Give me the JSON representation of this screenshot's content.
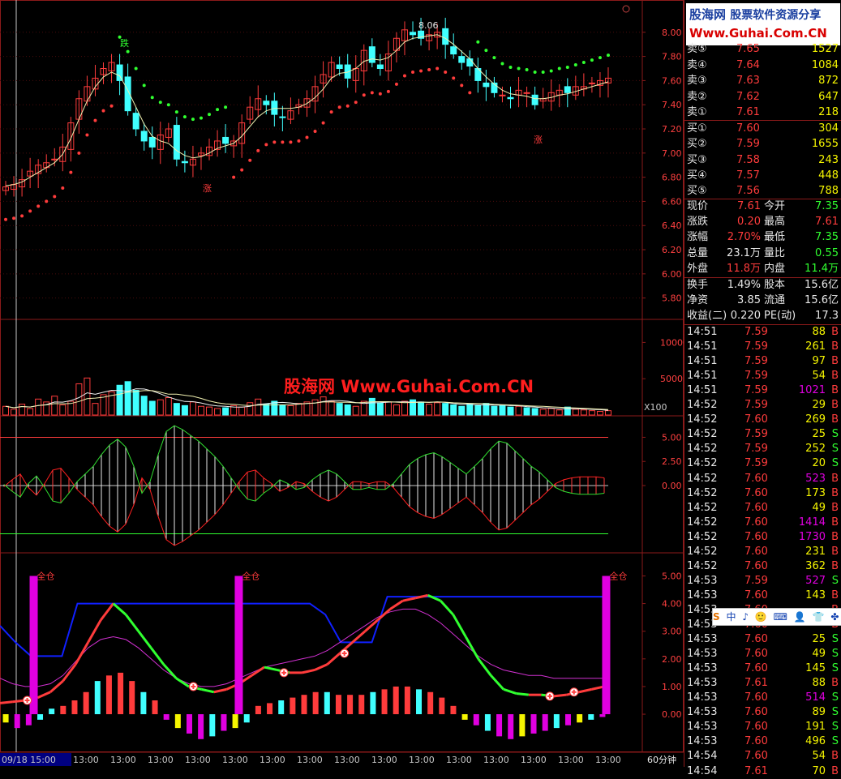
{
  "chart_data": [
    {
      "type": "candlestick",
      "panel": "price",
      "ylim": [
        5.65,
        8.2
      ],
      "yticks": [
        "8.00",
        "7.80",
        "7.60",
        "7.40",
        "7.20",
        "7.00",
        "6.80",
        "6.60",
        "6.40",
        "6.20",
        "6.00",
        "5.80"
      ],
      "ytick_values": [
        8.0,
        7.8,
        7.6,
        7.4,
        7.2,
        7.0,
        6.8,
        6.6,
        6.4,
        6.2,
        6.0,
        5.8
      ],
      "annotations": {
        "high_label": "8.06",
        "up_marker": "涨",
        "down_marker": "跌"
      },
      "close": [
        6.72,
        6.74,
        6.78,
        6.85,
        6.9,
        6.92,
        6.95,
        7.05,
        7.25,
        7.45,
        7.55,
        7.62,
        7.7,
        7.75,
        7.6,
        7.35,
        7.2,
        7.1,
        7.05,
        7.15,
        7.2,
        6.95,
        6.92,
        6.95,
        7.0,
        7.05,
        7.1,
        7.08,
        7.1,
        7.25,
        7.38,
        7.45,
        7.4,
        7.32,
        7.3,
        7.35,
        7.4,
        7.45,
        7.55,
        7.65,
        7.75,
        7.7,
        7.62,
        7.7,
        7.85,
        7.75,
        7.7,
        7.82,
        7.95,
        8.02,
        7.98,
        7.95,
        7.98,
        8.0,
        7.9,
        7.82,
        7.75,
        7.72,
        7.6,
        7.55,
        7.5,
        7.48,
        7.45,
        7.52,
        7.5,
        7.4,
        7.45,
        7.5,
        7.52,
        7.5,
        7.55,
        7.55,
        7.58,
        7.6,
        7.62
      ],
      "ma": [
        6.73,
        6.74,
        6.76,
        6.8,
        6.84,
        6.88,
        6.92,
        6.99,
        7.12,
        7.28,
        7.43,
        7.55,
        7.63,
        7.67,
        7.64,
        7.52,
        7.38,
        7.24,
        7.14,
        7.1,
        7.08,
        7.02,
        6.98,
        6.96,
        6.97,
        7.0,
        7.04,
        7.06,
        7.08,
        7.14,
        7.22,
        7.3,
        7.35,
        7.37,
        7.37,
        7.37,
        7.38,
        7.41,
        7.46,
        7.53,
        7.62,
        7.66,
        7.67,
        7.7,
        7.76,
        7.78,
        7.77,
        7.79,
        7.85,
        7.92,
        7.95,
        7.96,
        7.97,
        7.98,
        7.95,
        7.9,
        7.84,
        7.78,
        7.7,
        7.63,
        7.57,
        7.52,
        7.49,
        7.48,
        7.47,
        7.45,
        7.45,
        7.46,
        7.48,
        7.49,
        7.51,
        7.53,
        7.55,
        7.57,
        7.59
      ]
    },
    {
      "type": "bar",
      "panel": "volume",
      "ylim": [
        0,
        12500
      ],
      "yticks": [
        "10000",
        "5000"
      ],
      "ytick_values": [
        10000,
        5000
      ],
      "unit_label": "X100",
      "values": [
        1200,
        800,
        1500,
        900,
        2200,
        1800,
        2600,
        1400,
        1900,
        4300,
        5100,
        1600,
        2800,
        3200,
        4100,
        4600,
        3400,
        2600,
        1900,
        2100,
        2400,
        1600,
        1300,
        1800,
        1200,
        1100,
        900,
        1000,
        1300,
        1100,
        1700,
        2200,
        1500,
        1900,
        1400,
        1300,
        1600,
        1800,
        2100,
        2500,
        1900,
        1600,
        1400,
        1200,
        1900,
        2300,
        1700,
        1800,
        1400,
        1900,
        2100,
        1800,
        1500,
        1700,
        1600,
        1400,
        1200,
        1500,
        1300,
        1600,
        1200,
        1300,
        1100,
        1200,
        1000,
        900,
        800,
        900,
        700,
        1100,
        800,
        700,
        600,
        500,
        600
      ]
    },
    {
      "type": "line",
      "panel": "oscillator",
      "ylim": [
        -6.8,
        6.8
      ],
      "yticks": [
        "5.00",
        "2.50",
        "0.00"
      ],
      "ytick_values": [
        5.0,
        2.5,
        0.0
      ],
      "series": [
        {
          "color": "#ff2020",
          "values": [
            -0.1,
            0.6,
            1.2,
            -0.2,
            -1.0,
            0.2,
            1.6,
            1.8,
            0.8,
            -0.4,
            -1.2,
            -2.0,
            -3.2,
            -4.2,
            -4.8,
            -4.0,
            -2.0,
            0.8,
            -0.4,
            -3.2,
            -5.6,
            -6.2,
            -5.8,
            -5.2,
            -4.6,
            -3.8,
            -3.0,
            -2.0,
            -0.8,
            0.4,
            1.4,
            1.6,
            0.8,
            0.2,
            -0.6,
            -0.2,
            0.4,
            0.2,
            -0.6,
            -1.2,
            -1.6,
            -1.2,
            -0.4,
            0.4,
            0.4,
            0.2,
            0.4,
            0.4,
            -0.2,
            -1.2,
            -2.2,
            -2.8,
            -3.2,
            -3.4,
            -3.0,
            -2.4,
            -1.8,
            -1.2,
            -2.0,
            -2.8,
            -3.8,
            -4.6,
            -4.4,
            -3.6,
            -2.8,
            -2.0,
            -1.4,
            -0.6,
            0.2,
            0.6,
            0.8,
            0.9,
            0.9,
            0.9,
            0.8
          ]
        },
        {
          "color": "#30e030",
          "values": [
            0.1,
            -0.6,
            -1.2,
            0.2,
            1.0,
            -0.2,
            -1.6,
            -1.8,
            -0.8,
            0.4,
            1.2,
            2.0,
            3.2,
            4.2,
            4.8,
            4.0,
            2.0,
            -0.8,
            0.4,
            3.2,
            5.6,
            6.2,
            5.8,
            5.2,
            4.6,
            3.8,
            3.0,
            2.0,
            0.8,
            -0.4,
            -1.4,
            -1.6,
            -0.8,
            -0.2,
            0.6,
            0.2,
            -0.4,
            -0.2,
            0.6,
            1.2,
            1.6,
            1.2,
            0.4,
            -0.4,
            -0.4,
            -0.2,
            -0.4,
            -0.4,
            0.2,
            1.2,
            2.2,
            2.8,
            3.2,
            3.4,
            3.0,
            2.4,
            1.8,
            1.2,
            2.0,
            2.8,
            3.8,
            4.6,
            4.4,
            3.6,
            2.8,
            2.0,
            1.4,
            0.6,
            -0.2,
            -0.6,
            -0.8,
            -0.9,
            -0.9,
            -0.9,
            -0.8
          ]
        }
      ],
      "reference_lines": [
        5.0,
        0.0,
        -5.0
      ]
    },
    {
      "type": "line",
      "panel": "signal",
      "ylim": [
        -1.2,
        5.6
      ],
      "yticks": [
        "5.00",
        "4.00",
        "3.00",
        "2.00",
        "1.00",
        "0.00"
      ],
      "ytick_values": [
        5.0,
        4.0,
        3.0,
        2.0,
        1.0,
        0.0
      ],
      "signal_label": "全仓",
      "signal_at": [
        0.055,
        0.39,
        0.99
      ],
      "buy_marks_at": [
        0.045,
        0.32,
        0.47,
        0.57,
        0.91,
        0.95
      ],
      "series": [
        {
          "color": "#ff2020",
          "values": [
            0.4,
            0.45,
            0.5,
            0.6,
            0.8,
            1.2,
            1.8,
            2.6,
            3.4,
            4.0,
            3.6,
            3.0,
            2.4,
            1.8,
            1.3,
            1.0,
            0.9,
            0.8,
            0.9,
            1.1,
            1.4,
            1.7,
            1.6,
            1.5,
            1.5,
            1.6,
            1.8,
            2.2,
            2.6,
            3.0,
            3.4,
            3.8,
            4.1,
            4.2,
            4.3,
            4.1,
            3.6,
            2.8,
            2.0,
            1.4,
            0.9,
            0.75,
            0.7,
            0.7,
            0.65,
            0.7,
            0.8,
            0.9,
            1.0
          ]
        },
        {
          "color": "#30e030",
          "values": [
            0.4,
            0.45,
            0.5,
            0.6,
            0.8,
            1.2,
            1.8,
            2.6,
            3.4,
            4.0,
            3.6,
            3.0,
            2.4,
            1.8,
            1.3,
            1.0,
            0.9,
            0.8,
            0.9,
            1.1,
            1.4,
            1.7,
            1.6,
            1.5,
            1.5,
            1.6,
            1.8,
            2.2,
            2.6,
            3.0,
            3.4,
            3.8,
            4.1,
            4.2,
            4.3,
            4.1,
            3.6,
            2.8,
            2.0,
            1.4,
            0.9,
            0.75,
            0.7,
            0.7,
            0.65,
            0.7,
            0.8,
            0.9,
            1.0
          ]
        },
        {
          "color": "#d030d0",
          "values": [
            1.3,
            1.1,
            1.0,
            1.0,
            1.1,
            1.4,
            1.9,
            2.4,
            2.7,
            2.8,
            2.7,
            2.4,
            2.0,
            1.6,
            1.3,
            1.1,
            1.0,
            1.0,
            1.1,
            1.3,
            1.5,
            1.7,
            1.8,
            1.9,
            2.0,
            2.1,
            2.3,
            2.6,
            2.9,
            3.2,
            3.5,
            3.7,
            3.8,
            3.8,
            3.6,
            3.3,
            2.9,
            2.5,
            2.1,
            1.8,
            1.6,
            1.5,
            1.4,
            1.4,
            1.3,
            1.3,
            1.3,
            1.3,
            1.3
          ]
        },
        {
          "color": "#1020ff",
          "values": [
            3.2,
            2.6,
            2.1,
            2.1,
            2.1,
            4.0,
            4.0,
            4.0,
            4.0,
            4.0,
            4.0,
            4.0,
            4.0,
            4.0,
            4.0,
            4.0,
            4.0,
            4.0,
            4.0,
            4.0,
            4.0,
            3.6,
            2.6,
            2.6,
            2.6,
            4.25,
            4.25,
            4.25,
            4.25,
            4.25,
            4.25,
            4.25,
            4.25,
            4.25,
            4.25,
            4.25,
            4.25,
            4.25,
            4.25,
            4.25
          ]
        }
      ],
      "histogram": [
        -0.3,
        -0.5,
        -0.4,
        -0.2,
        0.2,
        0.3,
        0.5,
        0.8,
        1.2,
        1.4,
        1.5,
        1.2,
        0.8,
        0.5,
        -0.2,
        -0.5,
        -0.7,
        -0.9,
        -0.8,
        -0.6,
        -0.5,
        -0.3,
        0.3,
        0.4,
        0.5,
        0.6,
        0.7,
        0.8,
        0.8,
        0.7,
        0.7,
        0.7,
        0.8,
        0.9,
        1.0,
        1.0,
        0.9,
        0.8,
        0.6,
        0.3,
        -0.2,
        -0.4,
        -0.6,
        -0.8,
        -0.9,
        -0.8,
        -0.7,
        -0.6,
        -0.5,
        -0.4,
        -0.3,
        -0.2,
        -0.1
      ]
    }
  ],
  "x_axis": {
    "labels": [
      "09/18 15:00",
      "13:00",
      "13:00",
      "13:00",
      "13:00",
      "13:00",
      "13:00",
      "13:00",
      "13:00",
      "13:00",
      "13:00",
      "13:00",
      "13:00",
      "13:00",
      "13:00",
      "13:00"
    ],
    "period": "60分钟"
  },
  "watermark": "股海网 Www.Guhai.Com.CN",
  "logo": {
    "line1": "股海网",
    "line1b": "股票软件资源分享",
    "line2": "Www.Guhai.Com.CN"
  },
  "quote": {
    "sell": [
      {
        "label": "卖⑤",
        "price": "7.65",
        "vol": "1527"
      },
      {
        "label": "卖④",
        "price": "7.64",
        "vol": "1084"
      },
      {
        "label": "卖③",
        "price": "7.63",
        "vol": "872"
      },
      {
        "label": "卖②",
        "price": "7.62",
        "vol": "647"
      },
      {
        "label": "卖①",
        "price": "7.61",
        "vol": "218"
      }
    ],
    "buy": [
      {
        "label": "买①",
        "price": "7.60",
        "vol": "304"
      },
      {
        "label": "买②",
        "price": "7.59",
        "vol": "1655"
      },
      {
        "label": "买③",
        "price": "7.58",
        "vol": "243"
      },
      {
        "label": "买④",
        "price": "7.57",
        "vol": "448"
      },
      {
        "label": "买⑤",
        "price": "7.56",
        "vol": "788"
      }
    ],
    "stats": [
      {
        "l1": "现价",
        "v1": "7.61",
        "l2": "今开",
        "v2": "7.35",
        "c1": "up",
        "c2": "dn"
      },
      {
        "l1": "涨跌",
        "v1": "0.20",
        "l2": "最高",
        "v2": "7.61",
        "c1": "up",
        "c2": "up"
      },
      {
        "l1": "涨幅",
        "v1": "2.70%",
        "l2": "最低",
        "v2": "7.35",
        "c1": "up",
        "c2": "dn"
      },
      {
        "l1": "总量",
        "v1": "23.1万",
        "l2": "量比",
        "v2": "0.55",
        "c1": "wh",
        "c2": "dn"
      },
      {
        "l1": "外盘",
        "v1": "11.8万",
        "l2": "内盘",
        "v2": "11.4万",
        "c1": "up",
        "c2": "dn"
      }
    ],
    "info": [
      {
        "l1": "换手",
        "v1": "1.49%",
        "l2": "股本",
        "v2": "15.6亿"
      },
      {
        "l1": "净资",
        "v1": "3.85",
        "l2": "流通",
        "v2": "15.6亿"
      },
      {
        "l1": "收益(二)",
        "v1": "0.220",
        "l2": "PE(动)",
        "v2": "17.3"
      }
    ]
  },
  "ticks": [
    {
      "t": "14:51",
      "p": "7.59",
      "v": "88",
      "s": "B"
    },
    {
      "t": "14:51",
      "p": "7.59",
      "v": "261",
      "s": "B"
    },
    {
      "t": "14:51",
      "p": "7.59",
      "v": "97",
      "s": "B"
    },
    {
      "t": "14:51",
      "p": "7.59",
      "v": "54",
      "s": "B"
    },
    {
      "t": "14:51",
      "p": "7.59",
      "v": "1021",
      "s": "B"
    },
    {
      "t": "14:52",
      "p": "7.59",
      "v": "29",
      "s": "B"
    },
    {
      "t": "14:52",
      "p": "7.60",
      "v": "269",
      "s": "B"
    },
    {
      "t": "14:52",
      "p": "7.59",
      "v": "25",
      "s": "S"
    },
    {
      "t": "14:52",
      "p": "7.59",
      "v": "252",
      "s": "S"
    },
    {
      "t": "14:52",
      "p": "7.59",
      "v": "20",
      "s": "S"
    },
    {
      "t": "14:52",
      "p": "7.60",
      "v": "523",
      "s": "B"
    },
    {
      "t": "14:52",
      "p": "7.60",
      "v": "173",
      "s": "B"
    },
    {
      "t": "14:52",
      "p": "7.60",
      "v": "49",
      "s": "B"
    },
    {
      "t": "14:52",
      "p": "7.60",
      "v": "1414",
      "s": "B"
    },
    {
      "t": "14:52",
      "p": "7.60",
      "v": "1730",
      "s": "B"
    },
    {
      "t": "14:52",
      "p": "7.60",
      "v": "231",
      "s": "B"
    },
    {
      "t": "14:52",
      "p": "7.60",
      "v": "362",
      "s": "B"
    },
    {
      "t": "14:53",
      "p": "7.59",
      "v": "527",
      "s": "S"
    },
    {
      "t": "14:53",
      "p": "7.60",
      "v": "143",
      "s": "B"
    },
    {
      "t": "14:53",
      "p": "7.60",
      "v": "",
      "s": "B"
    },
    {
      "t": "14:53",
      "p": "7.60",
      "v": "",
      "s": "B"
    },
    {
      "t": "14:53",
      "p": "7.60",
      "v": "25",
      "s": "S"
    },
    {
      "t": "14:53",
      "p": "7.60",
      "v": "49",
      "s": "S"
    },
    {
      "t": "14:53",
      "p": "7.60",
      "v": "145",
      "s": "S"
    },
    {
      "t": "14:53",
      "p": "7.61",
      "v": "88",
      "s": "B"
    },
    {
      "t": "14:53",
      "p": "7.60",
      "v": "514",
      "s": "S"
    },
    {
      "t": "14:53",
      "p": "7.60",
      "v": "89",
      "s": "S"
    },
    {
      "t": "14:53",
      "p": "7.60",
      "v": "191",
      "s": "S"
    },
    {
      "t": "14:53",
      "p": "7.60",
      "v": "496",
      "s": "S"
    },
    {
      "t": "14:54",
      "p": "7.60",
      "v": "54",
      "s": "B"
    },
    {
      "t": "14:54",
      "p": "7.61",
      "v": "70",
      "s": "B"
    }
  ],
  "toolbar": {
    "items": [
      "S",
      "中",
      "♪",
      "🙂",
      "⌨",
      "👤",
      "👕",
      "✤"
    ]
  },
  "colors": {
    "up": "#ff3c3c",
    "down": "#30ff30",
    "cyan": "#40ffff",
    "magenta": "#e000e0",
    "frame": "#8b1a1a"
  }
}
